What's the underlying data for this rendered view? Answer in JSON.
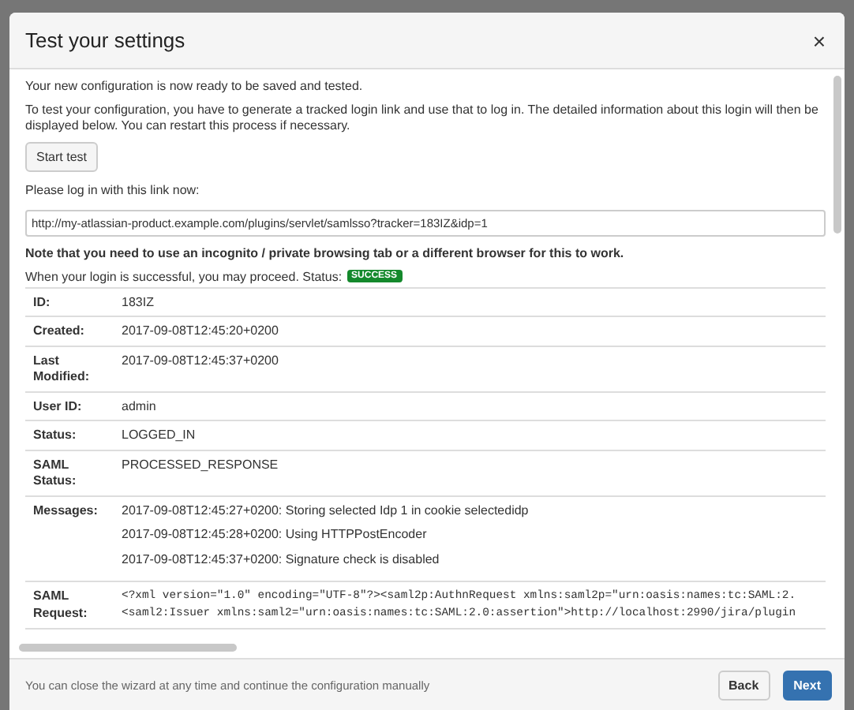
{
  "dialog": {
    "title": "Test your settings",
    "close": "×"
  },
  "intro": [
    "Your new configuration is now ready to be saved and tested.",
    "To test your configuration, you have to generate a tracked login link and use that to log in. The detailed information about this login will then be displayed below. You can restart this process if necessary."
  ],
  "start_button": "Start test",
  "link_label": "Please log in with this link now:",
  "link_field": {
    "value": "http://my-atlassian-product.example.com/plugins/servlet/samlsso?tracker=183IZ&idp=1"
  },
  "note": "Note that you need to use an incognito / private browsing tab or a different browser for this to work.",
  "status_line": {
    "text": "When your login is successful, you may proceed. Status:",
    "badge": "SUCCESS",
    "color": "#14892c"
  },
  "details": [
    {
      "kind": "text",
      "label": "ID:",
      "lines": [
        "183IZ"
      ]
    },
    {
      "kind": "text",
      "label": "Created:",
      "lines": [
        "2017-09-08T12:45:20+0200"
      ]
    },
    {
      "kind": "text",
      "label": "Last Modified:",
      "lines": [
        "2017-09-08T12:45:37+0200"
      ]
    },
    {
      "kind": "text",
      "label": "User ID:",
      "lines": [
        "admin"
      ]
    },
    {
      "kind": "text",
      "label": "Status:",
      "lines": [
        "LOGGED_IN"
      ]
    },
    {
      "kind": "text",
      "label": "SAML Status:",
      "lines": [
        "PROCESSED_RESPONSE"
      ]
    },
    {
      "kind": "list",
      "label": "Messages:",
      "lines": [
        "2017-09-08T12:45:27+0200: Storing selected Idp 1 in cookie selectedidp",
        "2017-09-08T12:45:28+0200: Using HTTPPostEncoder",
        "2017-09-08T12:45:37+0200: Signature check is disabled"
      ]
    },
    {
      "kind": "code",
      "label": "SAML Request:",
      "lines": [
        "<?xml version=\"1.0\" encoding=\"UTF-8\"?><saml2p:AuthnRequest xmlns:saml2p=\"urn:oasis:names:tc:SAML:2.",
        "<saml2:Issuer xmlns:saml2=\"urn:oasis:names:tc:SAML:2.0:assertion\">http://localhost:2990/jira/plugin"
      ]
    }
  ],
  "footer": {
    "text": "You can close the wizard at any time and continue the configuration manually",
    "buttons": [
      {
        "label": "Back",
        "primary": false
      },
      {
        "label": "Next",
        "primary": true
      }
    ]
  }
}
